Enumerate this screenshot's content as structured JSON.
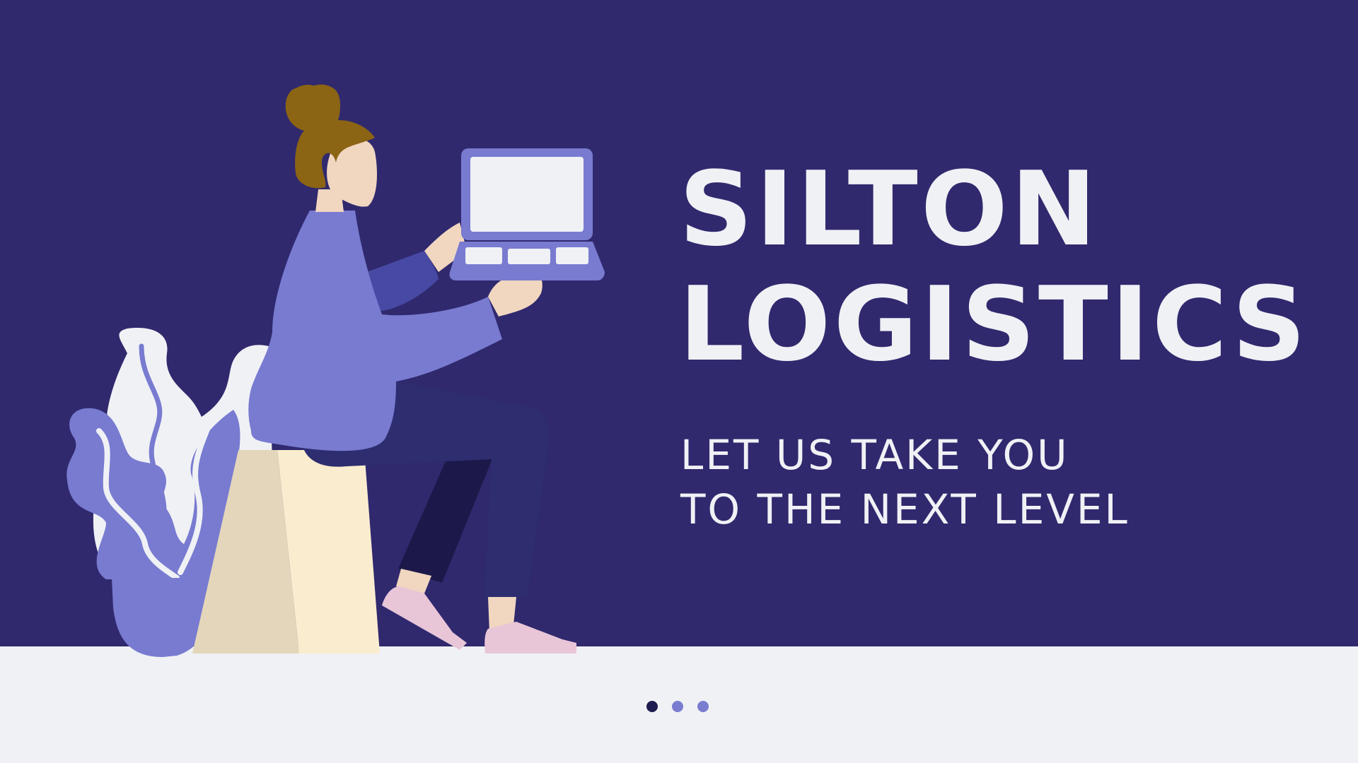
{
  "hero": {
    "title_line1": "SILTON",
    "title_line2": "LOGISTICS",
    "tagline_line1": "LET US TAKE YOU",
    "tagline_line2": "TO THE NEXT LEVEL"
  },
  "carousel": {
    "slide_count": 3,
    "active_index": 0
  },
  "colors": {
    "hero_background": "#30296e",
    "footer_background": "#f0f1f5",
    "text": "#f0f1f5",
    "dot_active": "#1e1b50",
    "dot_inactive": "#7a7ccf"
  }
}
